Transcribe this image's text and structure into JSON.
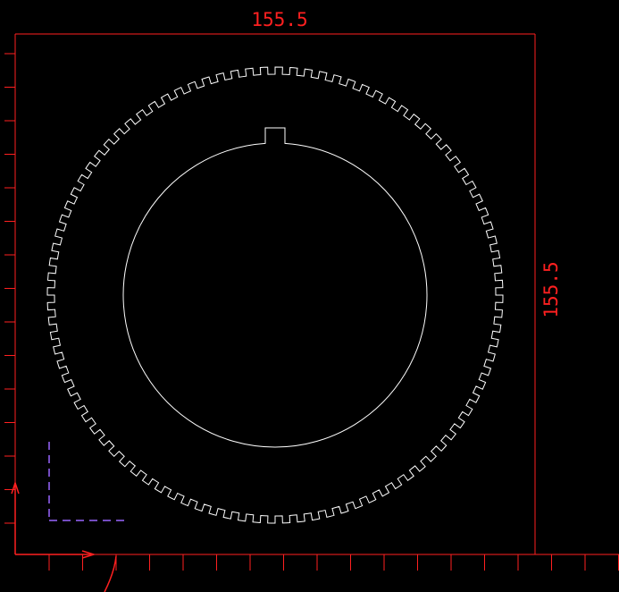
{
  "drawing": {
    "width_dimension": "155.5",
    "height_dimension": "155.5",
    "gear": {
      "tooth_count": 96
    }
  },
  "colors": {
    "background": "#000000",
    "geometry": "#ffffff",
    "dimension": "#ff2020",
    "ruler": "#ff2020",
    "ucs": "#9966ff"
  }
}
